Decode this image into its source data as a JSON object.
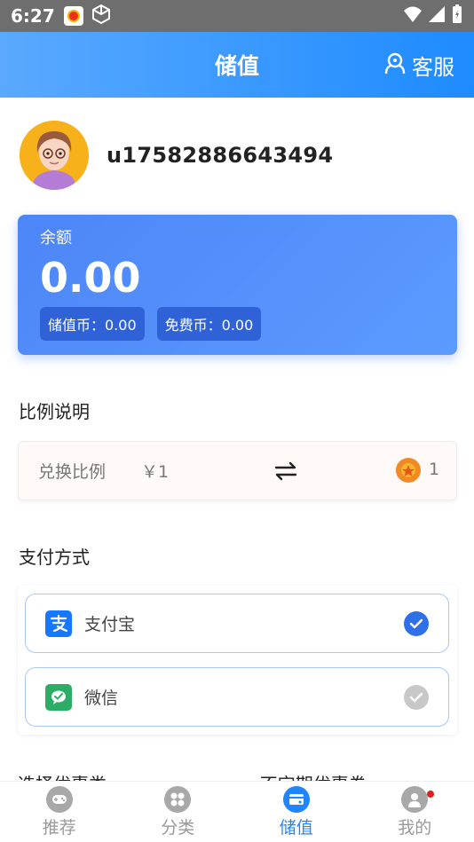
{
  "status_bar": {
    "time": "6:27"
  },
  "header": {
    "title": "储值",
    "customer_service": "客服"
  },
  "profile": {
    "username": "u17582886643494"
  },
  "balance": {
    "label": "余额",
    "amount": "0.00",
    "stored_coins": "储值币：0.00",
    "free_coins": "免费币：0.00"
  },
  "ratio": {
    "section_title": "比例说明",
    "label": "兑换比例",
    "yen": "￥1",
    "coin_value": "1"
  },
  "payment": {
    "section_title": "支付方式",
    "methods": [
      {
        "name": "支付宝",
        "selected": true
      },
      {
        "name": "微信",
        "selected": false
      }
    ]
  },
  "cut_off_text": "选择优惠类 …………………… 不定期优惠券",
  "tabs": [
    {
      "label": "推荐",
      "active": false
    },
    {
      "label": "分类",
      "active": false
    },
    {
      "label": "储值",
      "active": true
    },
    {
      "label": "我的",
      "active": false
    }
  ],
  "colors": {
    "accent": "#1f86ff",
    "alipay": "#1677ff",
    "wechat": "#2aae67"
  }
}
